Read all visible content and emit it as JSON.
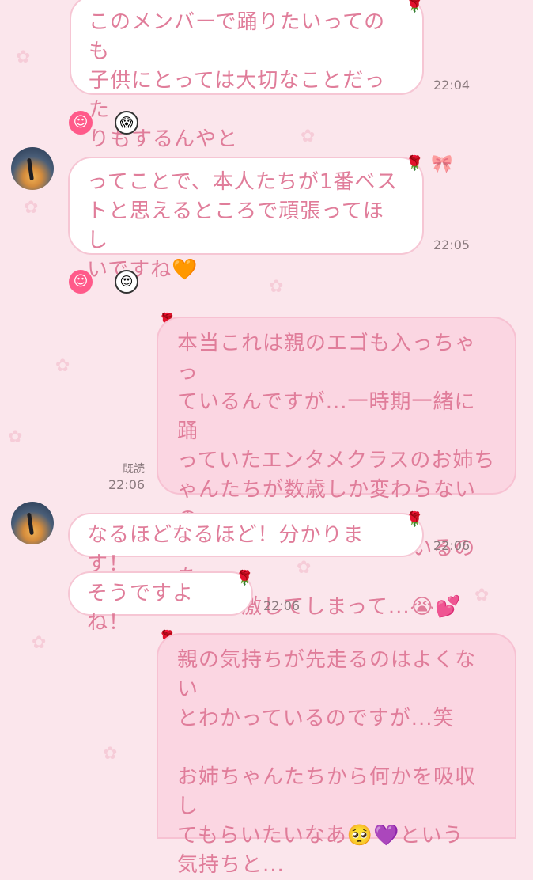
{
  "messages": [
    {
      "text": "このメンバーで踊りたいってのも\n子供にとっては大切なことだった\nりもするんやと",
      "time": "22:04"
    },
    {
      "text": "ってことで、本人たちが1番ベス\nトと思えるところで頑張ってほし\nいですね🧡",
      "time": "22:05"
    },
    {
      "text": "本当これは親のエゴも入っちゃっ\nているんですが...一時期一緒に踊\nっていたエンタメクラスのお姉ち\nゃんたちが数歳しか変わらないの\nにめちゃくちゃ上達しているのを\nみて感激してしまって...😭💕",
      "time": "22:06",
      "read": "既読"
    },
    {
      "text": "なるほどなるほど！分かります！",
      "time": "22:06"
    },
    {
      "text": "そうですよね！",
      "time": "22:06"
    },
    {
      "text": "親の気持ちが先走るのはよくない\nとわかっているのですが...笑\n\nお姉ちゃんたちから何かを吸収し\nてもらいたいなあ🥺💜という\n気持ちと..."
    }
  ],
  "reactions": {
    "r1": {
      "face": "☺",
      "stamp": "😱"
    },
    "r2": {
      "face": "☺",
      "stamp": "😍"
    }
  },
  "decor": {
    "rose": "🌹",
    "flower": "✿",
    "bow": "🎀"
  },
  "colors": {
    "background": "#fbe6ec",
    "text": "#e07d9a",
    "outgoing": "#fbd6e2"
  }
}
